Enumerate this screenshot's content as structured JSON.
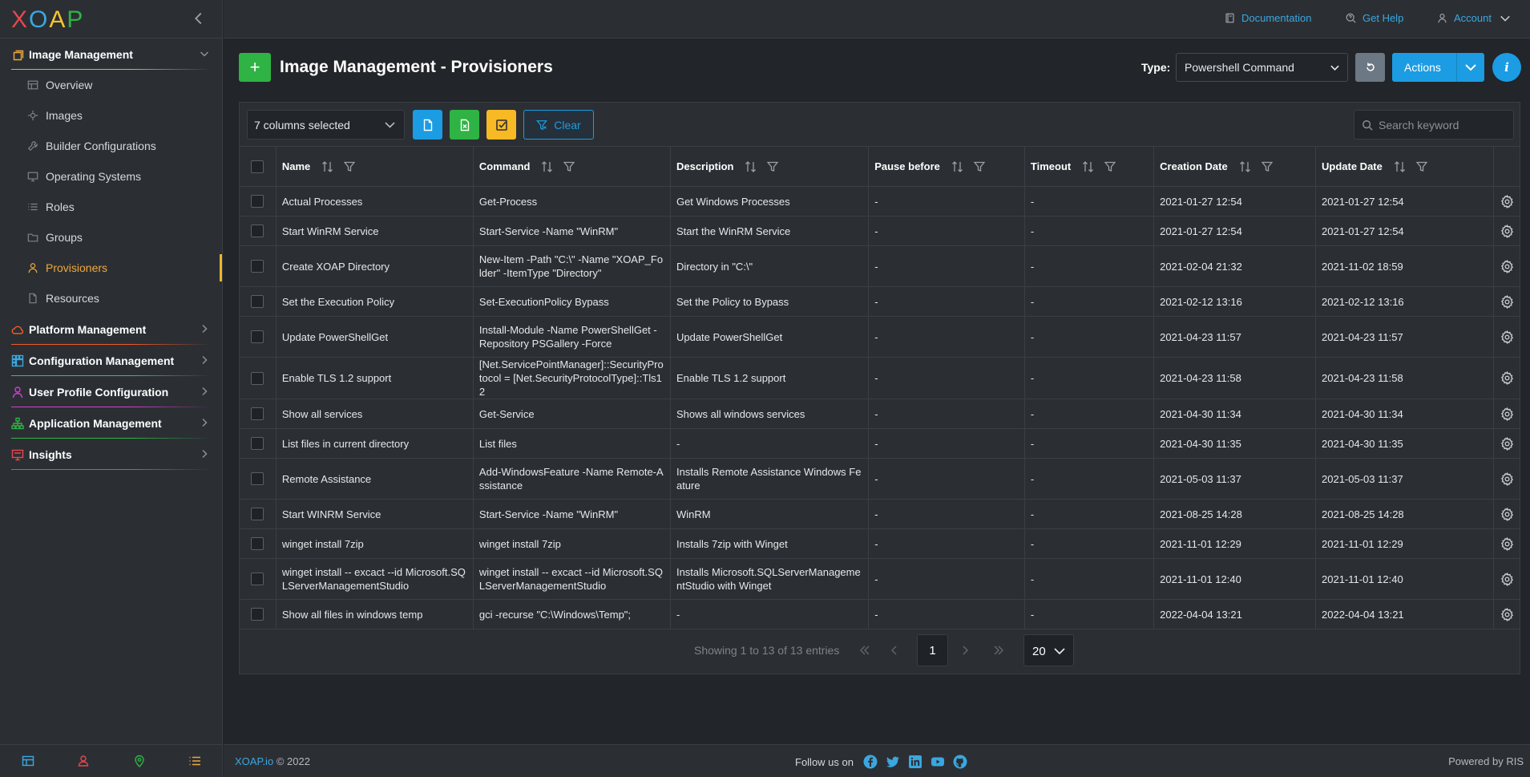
{
  "logo": {
    "letters": [
      "X",
      "O",
      "A",
      "P"
    ],
    "colors": [
      "#e5484d",
      "#3ba7e0",
      "#f7c32e",
      "#2fb344"
    ]
  },
  "topbar": {
    "documentation": "Documentation",
    "get_help": "Get Help",
    "account": "Account"
  },
  "sidebar": {
    "groups": [
      {
        "label": "Image Management",
        "icon": "stack-icon",
        "color": "#f0a83a",
        "expanded": true,
        "items": [
          {
            "label": "Overview",
            "icon": "table-icon"
          },
          {
            "label": "Images",
            "icon": "aperture-icon"
          },
          {
            "label": "Builder Configurations",
            "icon": "tool-icon"
          },
          {
            "label": "Operating Systems",
            "icon": "monitor-icon"
          },
          {
            "label": "Roles",
            "icon": "list-icon"
          },
          {
            "label": "Groups",
            "icon": "folder-icon"
          },
          {
            "label": "Provisioners",
            "icon": "user-icon",
            "active": true
          },
          {
            "label": "Resources",
            "icon": "file-icon"
          }
        ]
      },
      {
        "label": "Platform Management",
        "icon": "cloud-icon",
        "color": "#f05a28"
      },
      {
        "label": "Configuration Management",
        "icon": "grid-icon",
        "color": "#3ba7e0"
      },
      {
        "label": "User Profile Configuration",
        "icon": "user-icon",
        "color": "#d63ad6"
      },
      {
        "label": "Application Management",
        "icon": "sitemap-icon",
        "color": "#2fb344"
      },
      {
        "label": "Insights",
        "icon": "screen-icon",
        "color": "#e5484d"
      }
    ]
  },
  "header": {
    "add_label": "+",
    "title": "Image Management - Provisioners",
    "type_label": "Type:",
    "type_value": "Powershell Command",
    "actions_label": "Actions",
    "info_label": "i"
  },
  "toolbar": {
    "columns_selected": "7 columns selected",
    "clear_label": "Clear",
    "search_placeholder": "Search keyword"
  },
  "table": {
    "columns": [
      "Name",
      "Command",
      "Description",
      "Pause before",
      "Timeout",
      "Creation Date",
      "Update Date"
    ],
    "rows": [
      [
        "Actual Processes",
        "Get-Process",
        "Get Windows Processes",
        "-",
        "-",
        "2021-01-27 12:54",
        "2021-01-27 12:54"
      ],
      [
        "Start WinRM Service",
        "Start-Service -Name \"WinRM\"",
        "Start the WinRM Service",
        "-",
        "-",
        "2021-01-27 12:54",
        "2021-01-27 12:54"
      ],
      [
        "Create XOAP Directory",
        "New-Item -Path \"C:\\\" -Name \"XOAP_Folder\" -ItemType \"Directory\"",
        "Directory in \"C:\\\"",
        "-",
        "-",
        "2021-02-04 21:32",
        "2021-11-02 18:59"
      ],
      [
        "Set the Execution Policy",
        "Set-ExecutionPolicy Bypass",
        "Set the Policy to Bypass",
        "-",
        "-",
        "2021-02-12 13:16",
        "2021-02-12 13:16"
      ],
      [
        "Update PowerShellGet",
        "Install-Module -Name PowerShellGet -Repository PSGallery -Force",
        "Update PowerShellGet",
        "-",
        "-",
        "2021-04-23 11:57",
        "2021-04-23 11:57"
      ],
      [
        "Enable TLS 1.2 support",
        "[Net.ServicePointManager]::SecurityProtocol = [Net.SecurityProtocolType]::Tls12",
        "Enable TLS 1.2 support",
        "-",
        "-",
        "2021-04-23 11:58",
        "2021-04-23 11:58"
      ],
      [
        "Show all services",
        "Get-Service",
        "Shows all windows services",
        "-",
        "-",
        "2021-04-30 11:34",
        "2021-04-30 11:34"
      ],
      [
        "List files in current directory",
        "List files",
        "-",
        "-",
        "-",
        "2021-04-30 11:35",
        "2021-04-30 11:35"
      ],
      [
        "Remote Assistance",
        "Add-WindowsFeature -Name Remote-Assistance",
        "Installs Remote Assistance Windows Feature",
        "-",
        "-",
        "2021-05-03 11:37",
        "2021-05-03 11:37"
      ],
      [
        "Start WINRM Service",
        "Start-Service -Name \"WinRM\"",
        "WinRM",
        "-",
        "-",
        "2021-08-25 14:28",
        "2021-08-25 14:28"
      ],
      [
        "winget install 7zip",
        "winget install 7zip",
        "Installs 7zip with Winget",
        "-",
        "-",
        "2021-11-01 12:29",
        "2021-11-01 12:29"
      ],
      [
        "winget install -- excact --id Microsoft.SQLServerManagementStudio",
        "winget install -- excact --id Microsoft.SQLServerManagementStudio",
        "Installs Microsoft.SQLServerManagementStudio with Winget",
        "-",
        "-",
        "2021-11-01 12:40",
        "2021-11-01 12:40"
      ],
      [
        "Show all files in windows temp",
        "gci -recurse \"C:\\Windows\\Temp\";",
        "-",
        "-",
        "-",
        "2022-04-04 13:21",
        "2022-04-04 13:21"
      ]
    ]
  },
  "pagination": {
    "info": "Showing 1 to 13 of 13 entries",
    "current_page": "1",
    "page_size": "20"
  },
  "footer": {
    "brand": "XOAP.io",
    "copyright": "© 2022",
    "follow": "Follow us on",
    "powered": "Powered by RIS"
  }
}
